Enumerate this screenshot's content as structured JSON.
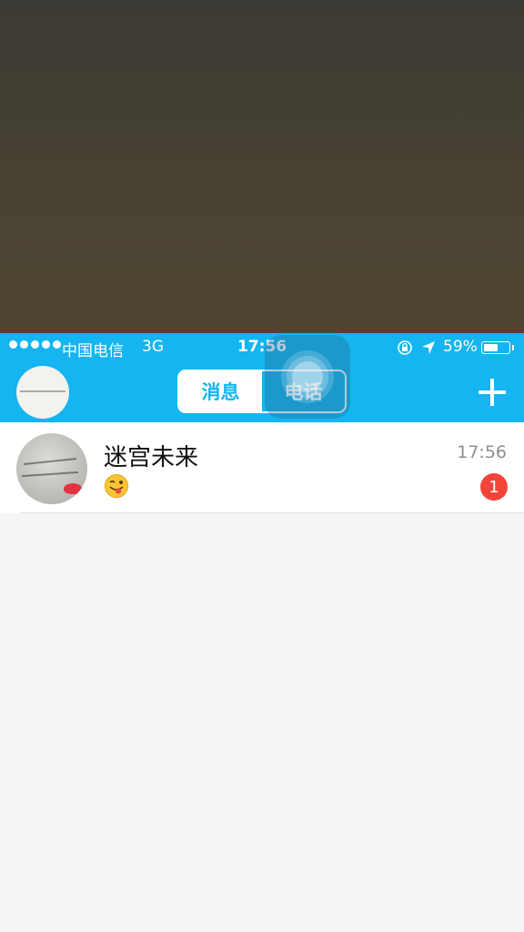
{
  "status_bar": {
    "carrier": "中国电信",
    "network": "3G",
    "time": "17:56",
    "battery_percent": "59%",
    "battery_level": 0.59
  },
  "header": {
    "tabs": [
      {
        "label": "消息",
        "active": true
      },
      {
        "label": "电话",
        "active": false
      }
    ],
    "accent_color": "#14b5f0"
  },
  "conversations": [
    {
      "name": "迷宫未来",
      "time": "17:56",
      "preview_icon": "tongue-wink-emoji-icon",
      "unread_count": "1"
    }
  ]
}
